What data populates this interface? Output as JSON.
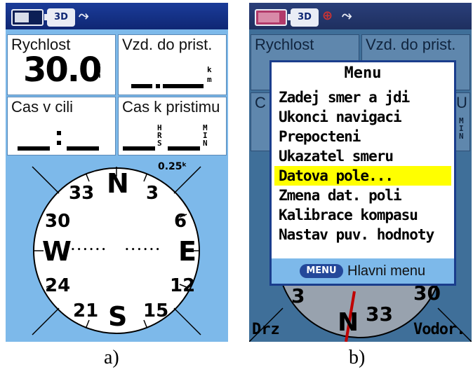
{
  "screen_a": {
    "status": {
      "mode_label": "3D",
      "sat_icon": "satellite-wave-icon",
      "battery_level": 0.5
    },
    "fields": {
      "speed": {
        "label": "Rychlost",
        "value": "30.0",
        "unit_top": "k",
        "unit_bottom": "h"
      },
      "dist_dest": {
        "label": "Vzd. do prist.",
        "unit_top": "k",
        "unit_bottom": "m"
      },
      "time_dest": {
        "label": "Cas v cili"
      },
      "time_next": {
        "label": "Cas k pristimu",
        "unit1": "HRS",
        "unit2": "MIN"
      }
    },
    "compass": {
      "scale": "0.25ᵏ",
      "cardinals": {
        "n": "N",
        "e": "E",
        "s": "S",
        "w": "W"
      },
      "numbers": {
        "n3": "3",
        "n6": "6",
        "n12": "12",
        "n15": "15",
        "n21": "21",
        "n24": "24",
        "n30": "30",
        "n33": "33"
      },
      "ticks_left": "••••••",
      "ticks_right": "••••••"
    }
  },
  "screen_b": {
    "status": {
      "mode_label": "3D",
      "compass_icon": "compass-rose-icon",
      "sat_icon": "satellite-wave-icon"
    },
    "bg_fields": {
      "speed_label": "Rychlost",
      "dist_label": "Vzd. do prist.",
      "c_label": "C",
      "u_label": "U",
      "min_label": "MIN"
    },
    "menu": {
      "title": "Menu",
      "items": [
        "Zadej smer a jdi",
        "Ukonci navigaci",
        "Prepocteni",
        "Ukazatel smeru",
        "Datova pole...",
        "Zmena dat. poli",
        "Kalibrace kompasu",
        "Nastav puv. hodnoty"
      ],
      "highlighted_index": 4,
      "footer_button": "MENU",
      "footer_label": "Hlavni menu"
    },
    "compass_bottom": {
      "n3": "3",
      "n30": "30",
      "n33": "33",
      "n": "N",
      "left_label": "Drz",
      "right_label": "Vodor."
    }
  },
  "captions": {
    "a": "a)",
    "b": "b)"
  },
  "colors": {
    "screen_bg": "#7db9ea",
    "statusbar": "#0f2774",
    "highlight": "#ffff00",
    "needle": "#d10000"
  }
}
